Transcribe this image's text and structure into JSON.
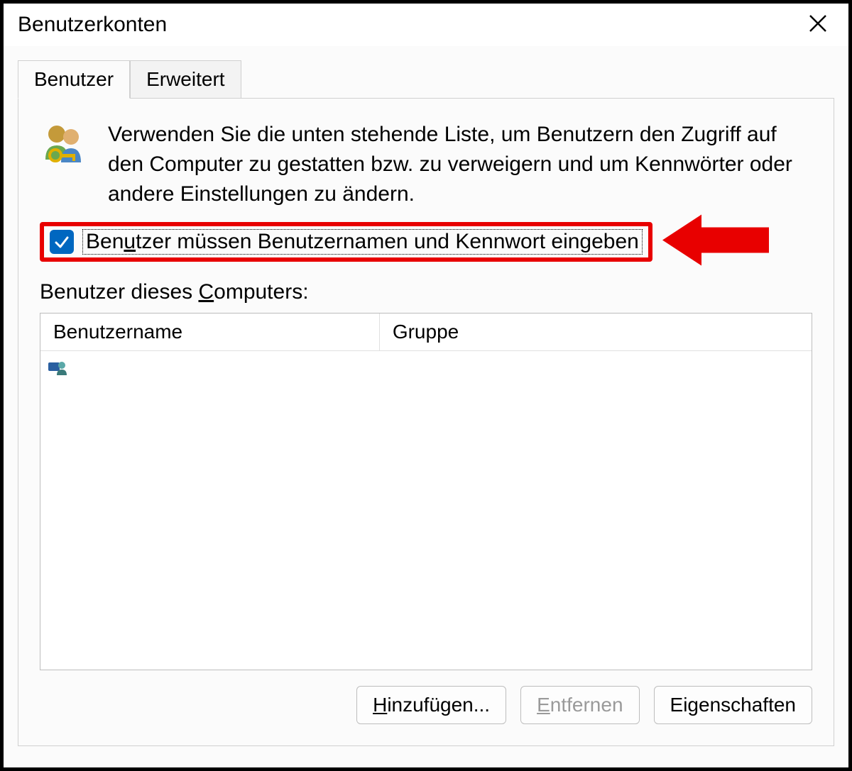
{
  "window": {
    "title": "Benutzerkonten"
  },
  "tabs": {
    "users": "Benutzer",
    "advanced": "Erweitert"
  },
  "info_text": "Verwenden Sie die unten stehende Liste, um Benutzern den Zugriff auf den Computer zu gestatten bzw. zu verweigern und um Kennwörter oder andere Einstellungen zu ändern.",
  "checkbox": {
    "checked": true,
    "label_pre": "Ben",
    "label_mn": "u",
    "label_post": "tzer müssen Benutzernamen und Kennwort eingeben"
  },
  "list": {
    "label_pre": "Benutzer dieses ",
    "label_mn": "C",
    "label_post": "omputers:",
    "columns": {
      "name": "Benutzername",
      "group": "Gruppe"
    },
    "rows": [
      {
        "name": "",
        "group": ""
      }
    ]
  },
  "buttons": {
    "add_pre": "",
    "add_mn": "H",
    "add_post": "inzufügen...",
    "remove_pre": "",
    "remove_mn": "E",
    "remove_post": "ntfernen",
    "properties": "Eigenschaften",
    "remove_disabled": true
  },
  "annotation": {
    "highlight_color": "#e80000",
    "arrow_color": "#e80000"
  }
}
